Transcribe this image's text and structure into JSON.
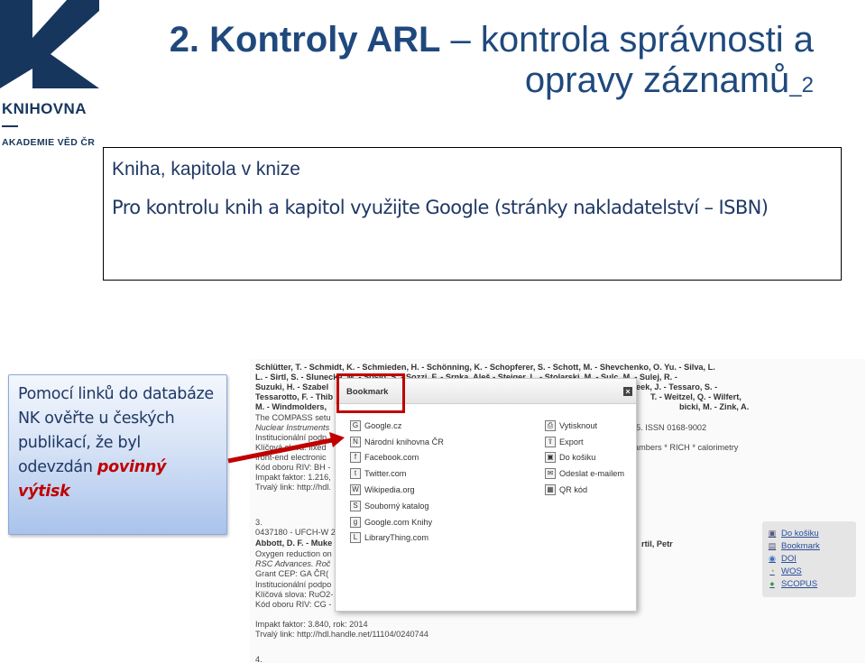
{
  "logo": {
    "name": "KNIHOVNA",
    "sub": "AKADEMIE VĚD ČR",
    "color": "#17365d"
  },
  "title": {
    "line1_bold": "2. Kontroly ARL",
    "line1_rest": " – kontrola správnosti a",
    "line2": "opravy záznamů",
    "suffix": "_2",
    "color": "#1f497d"
  },
  "box": {
    "heading": "Kniha, kapitola v knize",
    "text": "Pro kontrolu knih a kapitol využijte Google (stránky nakladatelství – ISBN)"
  },
  "callout": {
    "text": "Pomocí linků do databáze NK ověřte u českých publikací, že byl odevzdán ",
    "emphasis": "povinný výtisk",
    "emphasis_color": "#c00000"
  },
  "screenshot": {
    "lines": [
      "Schlütter, T. - Schmidt, K. - Schmieden, H. - Schönning, K. - Schopferer, S. - Schott, M. - Shevchenko, O. Yu. - Silva, L.",
      "L. - Sirtl, S. - Slunecka, M. - Sosio, S. - Sozzi, F. - Srnka, Aleš - Steiger, L. - Stolarski, M. - Sulc, M. - Sulej, R. -",
      "Suzuki, H. - Szabel",
      "Tessarotto, F. - Thib",
      "M. - Windmolders,",
      "The COMPASS setu",
      "Nuclear Instruments",
      "Institucionální podp",
      "Klíčová slova: fixed",
      "front-end electronic",
      "Kód oboru RIV: BH -",
      "Impakt faktor: 1.216,",
      "Trvalý link: http://hdl.",
      "3.",
      "0437180 - UFCH-W 2",
      "Abbott, D. F. - Muke",
      "Oxygen reduction on",
      "RSC Advances. Roč",
      "Grant CEP: GA ČR(",
      "Institucionální podpo",
      "Klíčová slova: RuO2-",
      "Kód oboru RIV: CG -",
      "Impakt faktor: 3.840, rok: 2014",
      "Trvalý link: http://hdl.handle.net/11104/0240744",
      "4."
    ],
    "right_fragments": [
      "eek, J. - Tessaro, S. -",
      "T. - Weitzel, Q. - Wilfert,",
      "bicki, M. - Zink, A.",
      "5. ISSN 0168-9002",
      "ambers * RICH * calorimetry",
      "rtil, Petr"
    ],
    "side_links": [
      {
        "label": "Do košiku",
        "icon": "cart-icon"
      },
      {
        "label": "Bookmark",
        "icon": "bookmark-icon"
      },
      {
        "label": "DOI",
        "icon": "doi-icon"
      },
      {
        "label": "WOS",
        "icon": "wos-icon"
      },
      {
        "label": "SCOPUS",
        "icon": "scopus-icon"
      }
    ],
    "popup": {
      "title": "Bookmark",
      "left_items": [
        {
          "label": "Google.cz",
          "icon": "google-icon"
        },
        {
          "label": "Národní knihovna ČR",
          "icon": "nk-icon"
        },
        {
          "label": "Facebook.com",
          "icon": "facebook-icon"
        },
        {
          "label": "Twitter.com",
          "icon": "twitter-icon"
        },
        {
          "label": "Wikipedia.org",
          "icon": "wikipedia-icon"
        },
        {
          "label": "Souborný katalog",
          "icon": "catalog-icon"
        },
        {
          "label": "Google.com Knihy",
          "icon": "google-books-icon"
        },
        {
          "label": "LibraryThing.com",
          "icon": "librarything-icon"
        }
      ],
      "right_items": [
        {
          "label": "Vytisknout",
          "icon": "print-icon"
        },
        {
          "label": "Export",
          "icon": "export-icon"
        },
        {
          "label": "Do košiku",
          "icon": "cart-icon"
        },
        {
          "label": "Odeslat e-mailem",
          "icon": "email-icon"
        },
        {
          "label": "QR kód",
          "icon": "qr-icon"
        }
      ]
    }
  }
}
